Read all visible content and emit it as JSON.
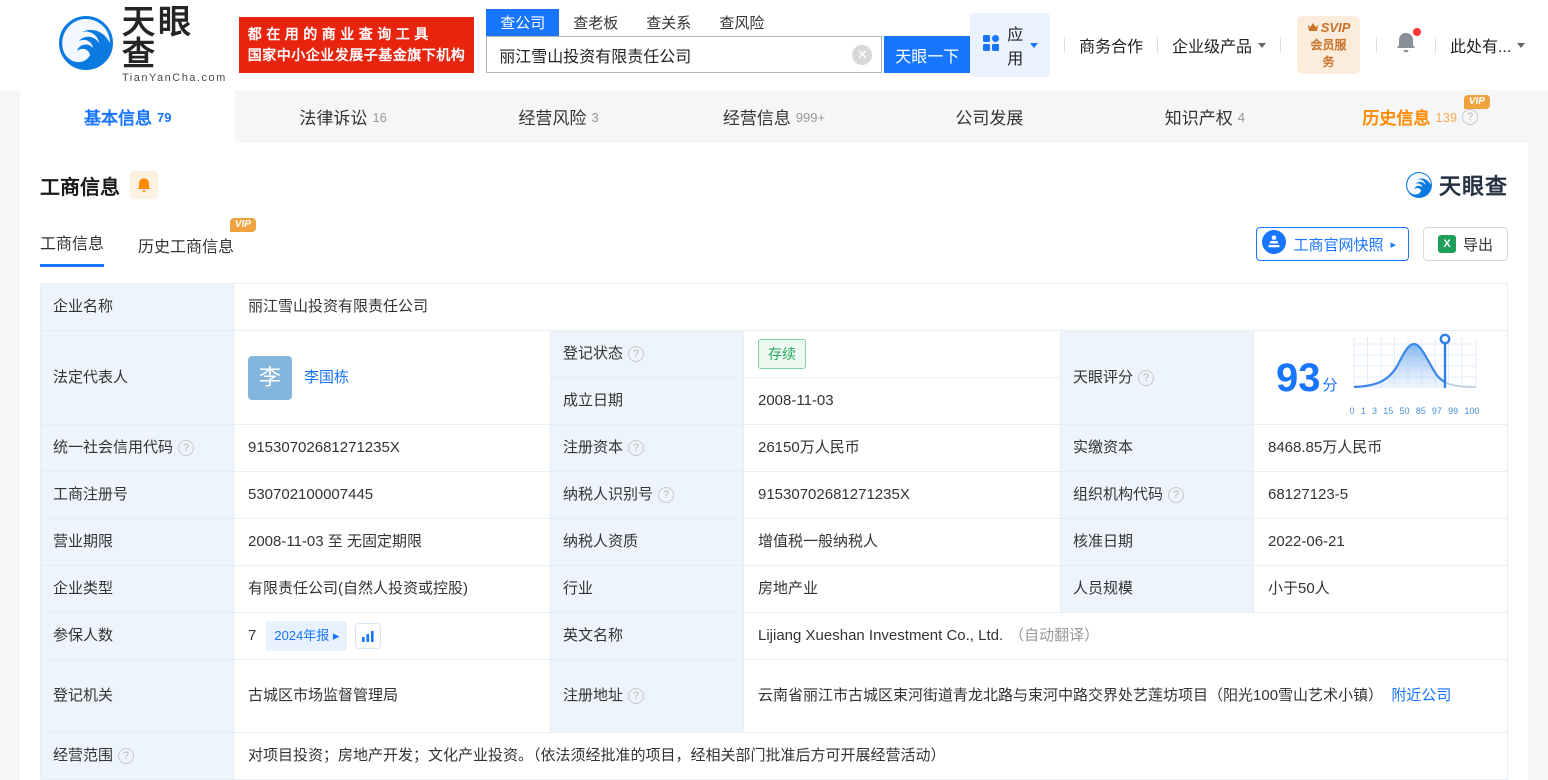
{
  "colors": {
    "brand_blue": "#1775ff",
    "banner_red": "#e8230e",
    "vip_orange": "#efa33e",
    "status_green": "#28a860"
  },
  "header": {
    "logo_title": "天眼查",
    "logo_sub": "TianYanCha.com",
    "banner_line1": "都在用的商业查询工具",
    "banner_line2": "国家中小企业发展子基金旗下机构",
    "search_tabs": {
      "company": "查公司",
      "boss": "查老板",
      "relation": "查关系",
      "risk": "查风险"
    },
    "search_value": "丽江雪山投资有限责任公司",
    "search_button": "天眼一下",
    "nav": {
      "apps": "应用",
      "cooperation": "商务合作",
      "enterprise": "企业级产品",
      "svip_top": "SVIP",
      "svip_bottom": "会员服务",
      "account": "此处有..."
    }
  },
  "tabs": {
    "basic": {
      "label": "基本信息",
      "count": "79"
    },
    "legal": {
      "label": "法律诉讼",
      "count": "16"
    },
    "risk": {
      "label": "经营风险",
      "count": "3"
    },
    "operating": {
      "label": "经营信息",
      "count": "999+"
    },
    "development": {
      "label": "公司发展"
    },
    "ip": {
      "label": "知识产权",
      "count": "4"
    },
    "history": {
      "label": "历史信息",
      "count": "139",
      "vip": "VIP"
    }
  },
  "section": {
    "title": "工商信息",
    "watermark": "天眼查",
    "subtab_current": "工商信息",
    "subtab_history": "历史工商信息",
    "vip": "VIP",
    "snapshot_button": "工商官网快照",
    "snapshot_arrow": "▸",
    "export_button": "导出"
  },
  "info": {
    "company_name": {
      "label": "企业名称",
      "value": "丽江雪山投资有限责任公司"
    },
    "legal_rep": {
      "label": "法定代表人",
      "avatar": "李",
      "value": "李国栋"
    },
    "reg_status": {
      "label": "登记状态",
      "value": "存续"
    },
    "established": {
      "label": "成立日期",
      "value": "2008-11-03"
    },
    "score": {
      "label": "天眼评分",
      "value": "93",
      "unit": "分",
      "axis": [
        "0",
        "1",
        "3",
        "15",
        "50",
        "85",
        "97",
        "99",
        "100"
      ]
    },
    "credit_code": {
      "label": "统一社会信用代码",
      "value": "91530702681271235X"
    },
    "reg_capital": {
      "label": "注册资本",
      "value": "26150万人民币"
    },
    "paid_capital": {
      "label": "实缴资本",
      "value": "8468.85万人民币"
    },
    "reg_number": {
      "label": "工商注册号",
      "value": "530702100007445"
    },
    "taxpayer_id": {
      "label": "纳税人识别号",
      "value": "91530702681271235X"
    },
    "org_code": {
      "label": "组织机构代码",
      "value": "68127123-5"
    },
    "business_term": {
      "label": "营业期限",
      "value": "2008-11-03 至 无固定期限"
    },
    "taxpayer_quality": {
      "label": "纳税人资质",
      "value": "增值税一般纳税人"
    },
    "approval_date": {
      "label": "核准日期",
      "value": "2022-06-21"
    },
    "company_type": {
      "label": "企业类型",
      "value": "有限责任公司(自然人投资或控股)"
    },
    "industry": {
      "label": "行业",
      "value": "房地产业"
    },
    "staff_size": {
      "label": "人员规模",
      "value": "小于50人"
    },
    "insured_count": {
      "label": "参保人数",
      "value": "7",
      "report_badge": "2024年报 ▸"
    },
    "english_name": {
      "label": "英文名称",
      "value": "Lijiang Xueshan Investment Co., Ltd.",
      "note": "（自动翻译）"
    },
    "reg_authority": {
      "label": "登记机关",
      "value": "古城区市场监督管理局"
    },
    "reg_address": {
      "label": "注册地址",
      "value": "云南省丽江市古城区束河街道青龙北路与束河中路交界处艺莲坊项目（阳光100雪山艺术小镇）",
      "nearby_link": "附近公司"
    },
    "business_scope": {
      "label": "经营范围",
      "value": "对项目投资；房地产开发；文化产业投资。（依法须经批准的项目，经相关部门批准后方可开展经营活动）"
    }
  }
}
